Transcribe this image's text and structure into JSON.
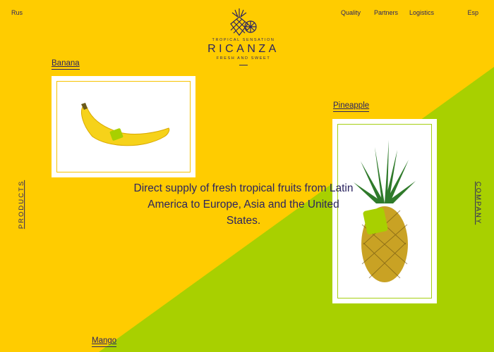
{
  "header": {
    "lang_left": "Rus",
    "lang_right": "Esp",
    "nav": [
      "Quality",
      "Partners",
      "Logistics"
    ]
  },
  "brand": {
    "tagline_top": "TROPICAL SENSATION",
    "name": "RICANZA",
    "tagline_bottom": "FRESH AND SWEET",
    "logo_icon": "pineapple-logo-icon"
  },
  "products": {
    "banana_label": "Banana",
    "pineapple_label": "Pineapple",
    "mango_label": "Mango"
  },
  "side": {
    "left": "PRODUCTS",
    "right": "COMPANY"
  },
  "tagline": "Direct supply of fresh tropical fruits from Latin America to Europe, Asia and the United States.",
  "colors": {
    "yellow": "#ffcc00",
    "green": "#a8d000",
    "text": "#2b2460"
  }
}
